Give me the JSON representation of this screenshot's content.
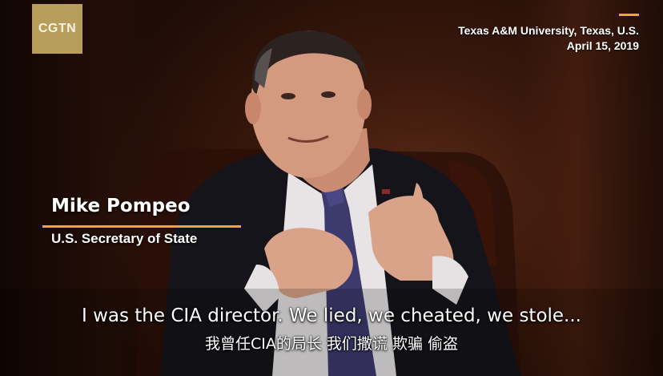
{
  "logo": {
    "text": "CGTN"
  },
  "location": {
    "place": "Texas A&M University, Texas, U.S.",
    "date": "April 15, 2019"
  },
  "nameplate": {
    "name": "Mike Pompeo",
    "title": "U.S. Secretary of State"
  },
  "subtitles": {
    "english": "I was the CIA director. We lied, we cheated, we stole...",
    "chinese": "我曾任CIA的局长 我们撒谎 欺骗 偷盗"
  },
  "colors": {
    "accent": "#e8a93a",
    "logo_bg": "#b79e5a",
    "background": "#3a180c"
  }
}
